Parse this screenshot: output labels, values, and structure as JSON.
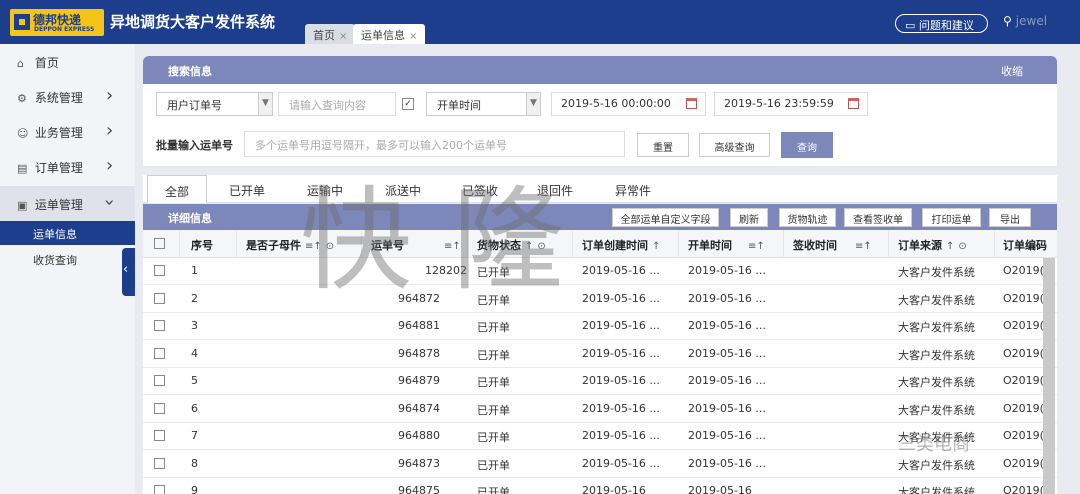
{
  "logo": {
    "cn": "德邦快递",
    "en": "DEPPON EXPRESS"
  },
  "app_title": "异地调货大客户发件系统",
  "page_tabs": [
    {
      "label": "首页",
      "close": "×"
    },
    {
      "label": "运单信息",
      "close": "×"
    }
  ],
  "header": {
    "feedback_label": "问题和建议",
    "user_name": "jewel"
  },
  "sidebar": {
    "items": [
      {
        "label": "首页",
        "icon": "home-icon"
      },
      {
        "label": "系统管理",
        "icon": "gear-icon"
      },
      {
        "label": "业务管理",
        "icon": "people-icon"
      },
      {
        "label": "订单管理",
        "icon": "document-icon"
      },
      {
        "label": "运单管理",
        "icon": "lock-icon"
      }
    ],
    "sub_items": [
      {
        "label": "运单信息"
      },
      {
        "label": "收货查询"
      }
    ]
  },
  "search": {
    "title": "搜索信息",
    "collapse_label": "收缩",
    "order_type_value": "用户订单号",
    "query_placeholder": "请输入查询内容",
    "time_type_value": "开单时间",
    "start_time": "2019-5-16 00:00:00",
    "end_time": "2019-5-16 23:59:59",
    "batch_label": "批量输入运单号",
    "batch_placeholder": "多个运单号用逗号隔开，最多可以输入200个运单号",
    "reset_label": "重置",
    "advanced_label": "高级查询",
    "query_label": "查询"
  },
  "status_tabs": [
    "全部",
    "已开单",
    "运输中",
    "派送中",
    "已签收",
    "退回件",
    "异常件"
  ],
  "detail": {
    "title": "详细信息",
    "buttons": [
      "全部运单自定义字段",
      "刷新",
      "货物轨迹",
      "查看签收单",
      "打印运单",
      "导出"
    ]
  },
  "table": {
    "columns": [
      "序号",
      "是否子母件",
      "运单号",
      "货物状态",
      "订单创建时间",
      "开单时间",
      "签收时间",
      "订单来源",
      "订单编码"
    ],
    "sort_marks": [
      "≡↑",
      "⊙",
      "≡↑",
      "↑",
      "⊙",
      "↑",
      "≡↑",
      "≡↑",
      "↑",
      "⊙"
    ],
    "rows": [
      {
        "seq": "1",
        "waybill": "128202",
        "status": "已开单",
        "created": "2019-05-16 ...",
        "opened": "2019-05-16 ...",
        "source": "大客户发件系统",
        "code": "O2019("
      },
      {
        "seq": "2",
        "waybill": "964872",
        "status": "已开单",
        "created": "2019-05-16 ...",
        "opened": "2019-05-16 ...",
        "source": "大客户发件系统",
        "code": "O2019("
      },
      {
        "seq": "3",
        "waybill": "964881",
        "status": "已开单",
        "created": "2019-05-16 ...",
        "opened": "2019-05-16 ...",
        "source": "大客户发件系统",
        "code": "O2019("
      },
      {
        "seq": "4",
        "waybill": "964878",
        "status": "已开单",
        "created": "2019-05-16 ...",
        "opened": "2019-05-16 ...",
        "source": "大客户发件系统",
        "code": "O2019("
      },
      {
        "seq": "5",
        "waybill": "964879",
        "status": "已开单",
        "created": "2019-05-16 ...",
        "opened": "2019-05-16 ...",
        "source": "大客户发件系统",
        "code": "O2019("
      },
      {
        "seq": "6",
        "waybill": "964874",
        "status": "已开单",
        "created": "2019-05-16 ...",
        "opened": "2019-05-16 ...",
        "source": "大客户发件系统",
        "code": "O2019("
      },
      {
        "seq": "7",
        "waybill": "964880",
        "status": "已开单",
        "created": "2019-05-16 ...",
        "opened": "2019-05-16 ...",
        "source": "大客户发件系统",
        "code": "O2019("
      },
      {
        "seq": "8",
        "waybill": "964873",
        "status": "已开单",
        "created": "2019-05-16 ...",
        "opened": "2019-05-16 ...",
        "source": "大客户发件系统",
        "code": "O2019("
      },
      {
        "seq": "9",
        "waybill": "964875",
        "status": "已开单",
        "created": "2019-05-16",
        "opened": "2019-05-16",
        "source": "大客户发件系统",
        "code": "O2019("
      }
    ]
  },
  "watermarks": {
    "main": "快隆",
    "small": "三类电商"
  },
  "colors": {
    "brand": "#1d3e8c",
    "panel": "#7d87b9",
    "logo": "#f5c417"
  }
}
